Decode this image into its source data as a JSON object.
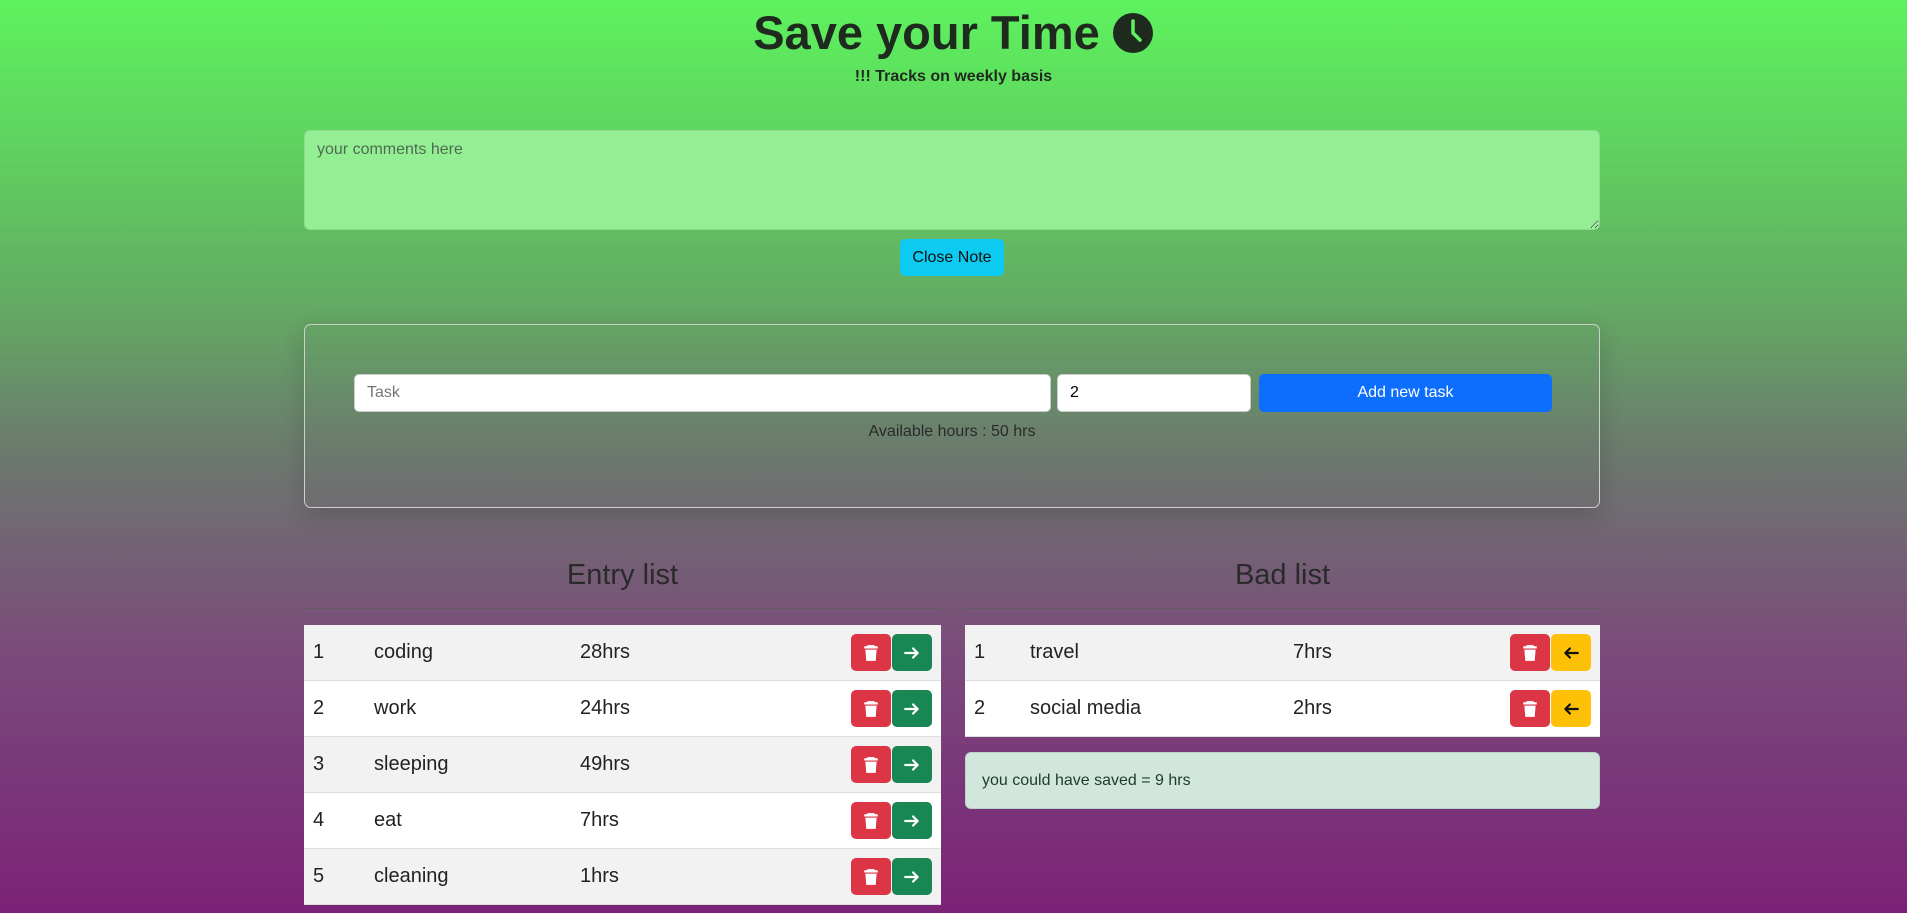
{
  "header": {
    "title": "Save your Time",
    "title_icon": "clock-icon",
    "subtitle": "!!! Tracks on weekly basis"
  },
  "note": {
    "placeholder": "your comments here",
    "value": "",
    "close_label": "Close Note"
  },
  "form": {
    "task_placeholder": "Task",
    "hours_value": "2",
    "add_label": "Add new task",
    "available_text": "Available hours : 50 hrs"
  },
  "entry_list": {
    "title": "Entry list",
    "rows": [
      {
        "index": "1",
        "task": "coding",
        "hours": "28hrs"
      },
      {
        "index": "2",
        "task": "work",
        "hours": "24hrs"
      },
      {
        "index": "3",
        "task": "sleeping",
        "hours": "49hrs"
      },
      {
        "index": "4",
        "task": "eat",
        "hours": "7hrs"
      },
      {
        "index": "5",
        "task": "cleaning",
        "hours": "1hrs"
      }
    ]
  },
  "bad_list": {
    "title": "Bad list",
    "rows": [
      {
        "index": "1",
        "task": "travel",
        "hours": "7hrs"
      },
      {
        "index": "2",
        "task": "social media",
        "hours": "2hrs"
      }
    ],
    "saved_text": "you could have saved = 9 hrs"
  },
  "colors": {
    "delete": "#dc3545",
    "move_right": "#198754",
    "move_left": "#ffc107",
    "add": "#0d6efd",
    "close_note": "#0dcaf0"
  }
}
